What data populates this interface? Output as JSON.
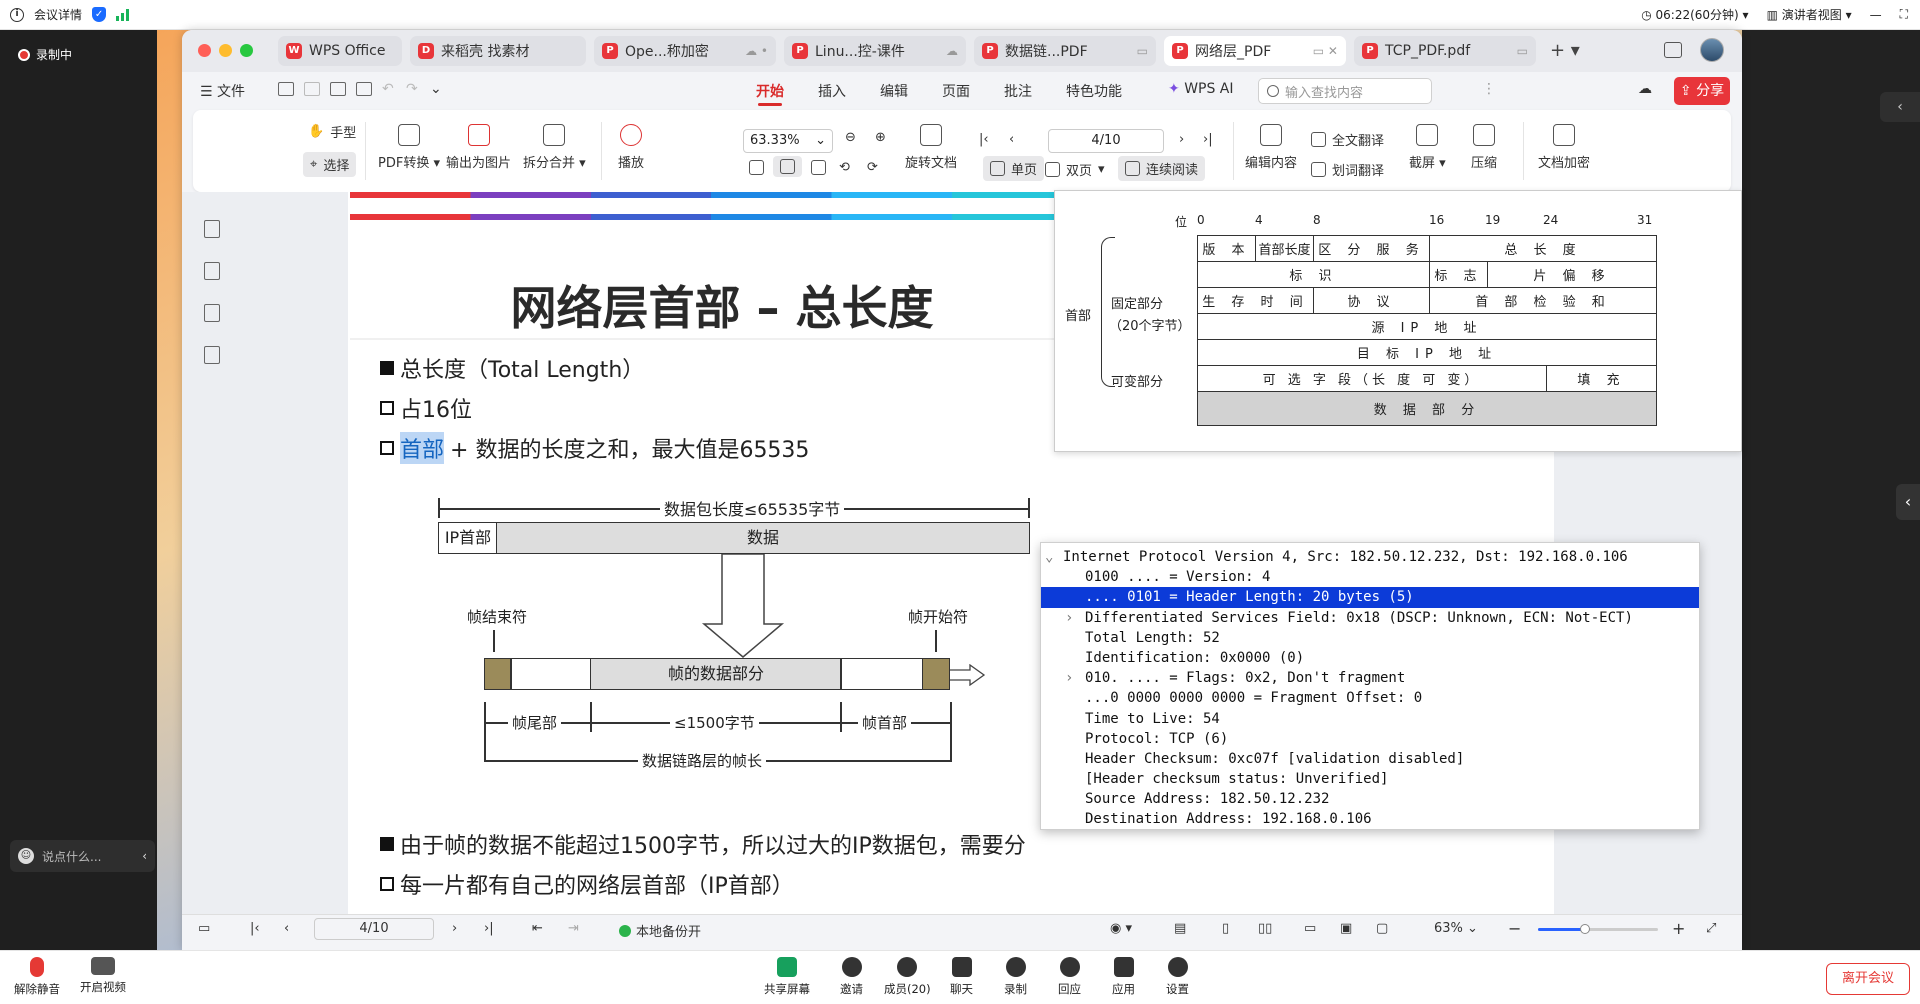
{
  "meeting": {
    "info_label": "会议详情",
    "time_label": "06:22(60分钟)",
    "view_label": "演讲者视图",
    "recording_label": "录制中",
    "chat_placeholder": "说点什么...",
    "bottom": {
      "unmute": "解除静音",
      "video": "开启视频",
      "share": "共享屏幕",
      "invite": "邀请",
      "members": "成员(20)",
      "chat": "聊天",
      "record": "录制",
      "react": "回应",
      "apps": "应用",
      "settings": "设置",
      "leave": "离开会议"
    }
  },
  "wps": {
    "tabs": [
      {
        "label": "WPS Office",
        "icon": "W",
        "color": "#e8353a"
      },
      {
        "label": "来稻壳 找素材",
        "icon": "D",
        "color": "#e8353a"
      },
      {
        "label": "Ope...称加密",
        "icon": "P",
        "color": "#e8353a"
      },
      {
        "label": "Linu...控-课件",
        "icon": "P",
        "color": "#e8353a"
      },
      {
        "label": "数据链...PDF",
        "icon": "P",
        "color": "#e8353a"
      },
      {
        "label": "网络层_PDF",
        "icon": "P",
        "color": "#e8353a"
      },
      {
        "label": "TCP_PDF.pdf",
        "icon": "P",
        "color": "#e8353a"
      }
    ],
    "menu": {
      "file": "文件",
      "items": [
        "开始",
        "插入",
        "编辑",
        "页面",
        "批注",
        "特色功能"
      ],
      "ai": "WPS AI",
      "search_placeholder": "输入查找内容",
      "share": "分享"
    },
    "ribbon": {
      "hand": "手型",
      "select": "选择",
      "pdf_convert": "PDF转换",
      "to_image": "输出为图片",
      "split_merge": "拆分合并",
      "play": "播放",
      "zoom": "63.33%",
      "rotate": "旋转文档",
      "page": "4/10",
      "single": "单页",
      "double": "双页",
      "continuous": "连续阅读",
      "edit": "编辑内容",
      "translate_all": "全文翻译",
      "translate_word": "划词翻译",
      "screenshot": "截屏",
      "compress": "压缩",
      "encrypt": "文档加密"
    },
    "status": {
      "page": "4/10",
      "backup": "本地备份开",
      "zoom": "63%"
    }
  },
  "slide": {
    "title": "网络层首部 – 总长度",
    "bullets": [
      "总长度（Total Length）",
      "占16位",
      "首部",
      "+ 数据的长度之和，最大值是65535",
      "由于帧的数据不能超过1500字节，所以过大的IP数据包，需要分",
      "每一片都有自己的网络层首部（IP首部）"
    ],
    "diagram": {
      "packet_len": "数据包长度≤65535字节",
      "ip_header": "IP首部",
      "data": "数据",
      "frame_end": "帧结束符",
      "frame_start": "帧开始符",
      "frame_data": "帧的数据部分",
      "trailer": "帧尾部",
      "le1500": "≤1500字节",
      "frame_header": "帧首部",
      "frame_len": "数据链路层的帧长"
    }
  },
  "ip_header_format": {
    "bit_label": "位",
    "bits": [
      "0",
      "4",
      "8",
      "16",
      "19",
      "24",
      "31"
    ],
    "header_label": "首部",
    "fixed_label": "固定部分",
    "fixed_size": "（20个字节）",
    "variable_label": "可变部分",
    "rows": [
      [
        "版 本",
        "首部长度",
        "区 分 服 务",
        "总 长 度"
      ],
      [
        "标 识",
        "标 志",
        "片 偏 移"
      ],
      [
        "生 存 时 间",
        "协 议",
        "首 部 检 验 和"
      ],
      [
        "源 IP 地 址"
      ],
      [
        "目 标 IP 地 址"
      ],
      [
        "可 选 字 段（长 度 可 变）",
        "填 充"
      ],
      [
        "数 据 部 分"
      ]
    ]
  },
  "wireshark": {
    "lines": [
      "Internet Protocol Version 4, Src: 182.50.12.232, Dst: 192.168.0.106",
      "0100 .... = Version: 4",
      ".... 0101 = Header Length: 20 bytes (5)",
      "Differentiated Services Field: 0x18 (DSCP: Unknown, ECN: Not-ECT)",
      "Total Length: 52",
      "Identification: 0x0000 (0)",
      "010. .... = Flags: 0x2, Don't fragment",
      "...0 0000 0000 0000 = Fragment Offset: 0",
      "Time to Live: 54",
      "Protocol: TCP (6)",
      "Header Checksum: 0xc07f [validation disabled]",
      "[Header checksum status: Unverified]",
      "Source Address: 182.50.12.232",
      "Destination Address: 192.168.0.106"
    ]
  }
}
